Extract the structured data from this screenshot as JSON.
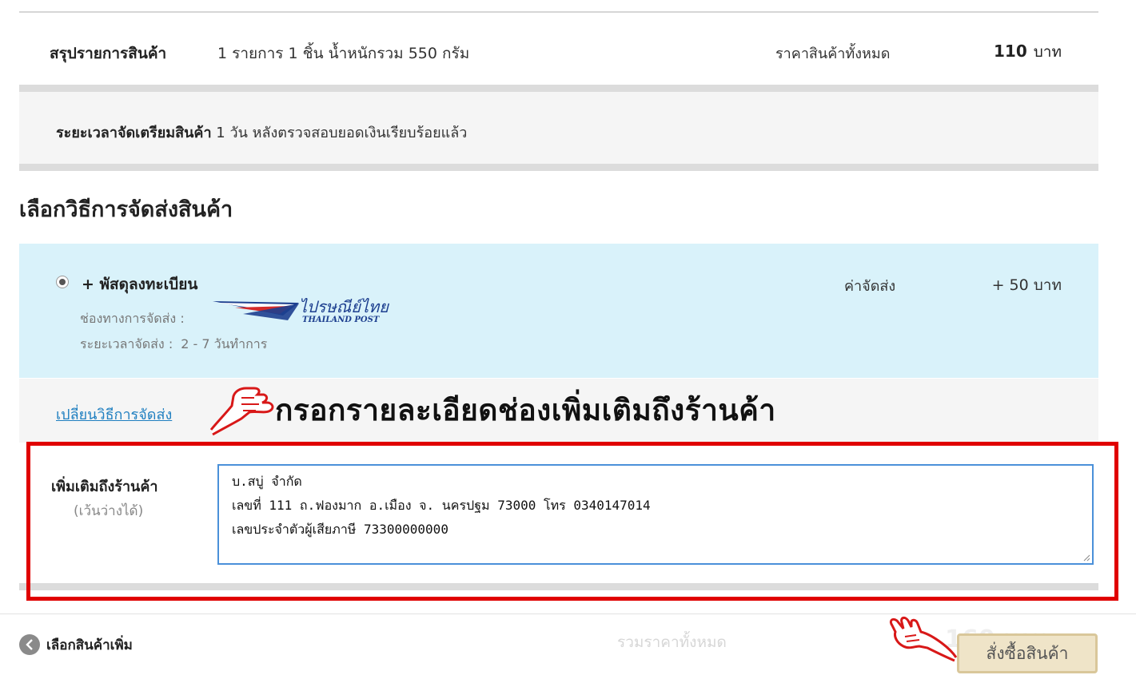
{
  "summary": {
    "label": "สรุปรายการสินค้า",
    "detail": "1 รายการ 1 ชิ้น น้ำหนักรวม 550 กรัม",
    "total_label": "ราคาสินค้าทั้งหมด",
    "total_value": "110",
    "currency": "บาท"
  },
  "prep": {
    "label": "ระยะเวลาจัดเตรียมสินค้า",
    "text": "1 วัน หลังตรวจสอบยอดเงินเรียบร้อยแล้ว"
  },
  "shipping": {
    "title": "เลือกวิธีการจัดส่งสินค้า",
    "option_name": "+ พัสดุลงทะเบียน",
    "fee_label": "ค่าจัดส่ง",
    "fee_value": "+ 50 บาท",
    "channel_label": "ช่องทางการจัดส่ง :",
    "time_label": "ระยะเวลาจัดส่ง :",
    "time_value": "2 - 7 วันทำการ",
    "logo_thai": "ไปรษณีย์ไทย",
    "logo_en": "THAILAND POST",
    "change_link": "เปลี่ยนวิธีการจัดส่ง"
  },
  "annotation": {
    "text": "กรอกรายละเอียดช่องเพิ่มเติมถึงร้านค้า",
    "frame_color": "#e00000"
  },
  "note": {
    "label": "เพิ่มเติมถึงร้านค้า",
    "sublabel": "(เว้นว่างได้)",
    "lines": [
      "บ.สบู่ จำกัด",
      "เลขที่ 111 ถ.ฟองมาก อ.เมือง จ. นครปฐม 73000 โทร 0340147014",
      "เลขประจำตัวผู้เสียภาษี 73300000000"
    ]
  },
  "footer": {
    "back_label": "เลือกสินค้าเพิ่ม",
    "sum_label": "รวมราคาทั้งหมด",
    "sum_value": "160 บาท",
    "order_button": "สั่งซื้อสินค้า"
  }
}
